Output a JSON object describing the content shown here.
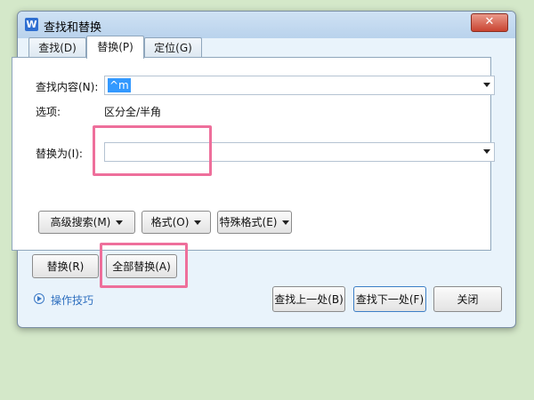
{
  "window": {
    "title": "查找和替换",
    "close_symbol": "✕"
  },
  "tabs": [
    {
      "label": "查找(D)",
      "active": false
    },
    {
      "label": "替换(P)",
      "active": true
    },
    {
      "label": "定位(G)",
      "active": false
    }
  ],
  "find": {
    "label": "查找内容(N):",
    "value": "^m"
  },
  "options": {
    "label": "选项:",
    "value": "区分全/半角"
  },
  "replace": {
    "label": "替换为(I):",
    "value": ""
  },
  "buttons": {
    "advanced_search": "高级搜索(M)",
    "format": "格式(O)",
    "special_format": "特殊格式(E)",
    "replace": "替换(R)",
    "replace_all": "全部替换(A)",
    "find_prev": "查找上一处(B)",
    "find_next": "查找下一处(F)",
    "close": "关闭"
  },
  "tips_link": "操作技巧",
  "colors": {
    "background": "#d4e8c9",
    "highlight": "#ee6f9b",
    "selection": "#3399ff",
    "link": "#2e6fbf"
  }
}
